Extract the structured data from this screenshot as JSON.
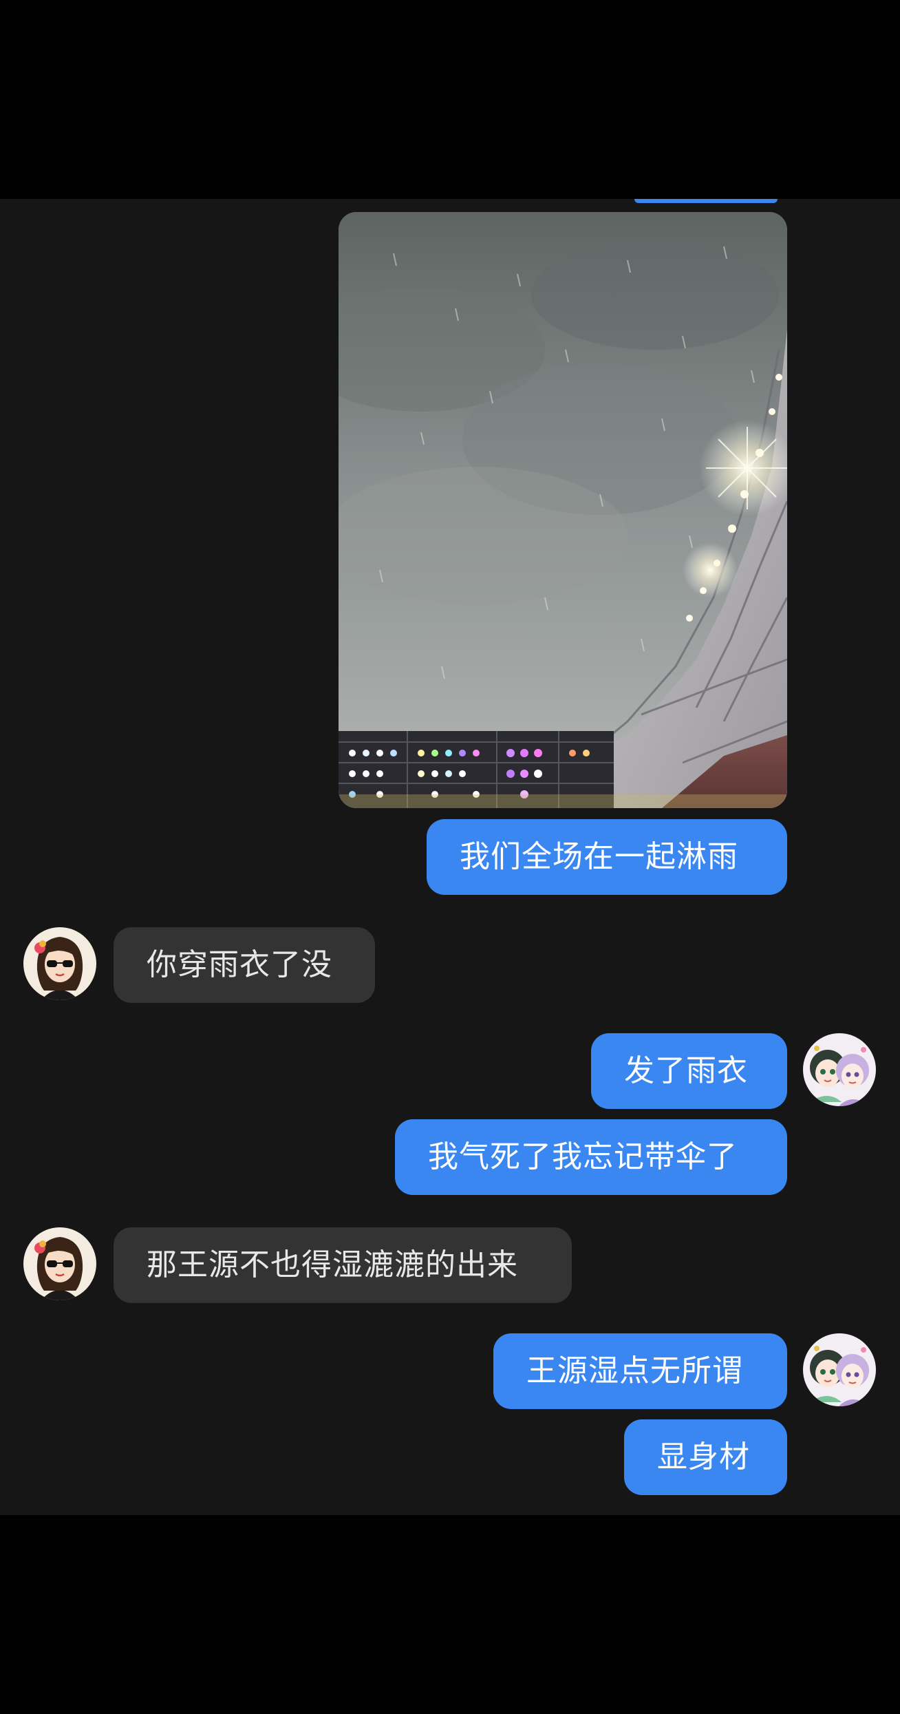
{
  "messages": [
    {
      "id": "m1",
      "from": "me",
      "type": "image",
      "alt": "photo"
    },
    {
      "id": "m2",
      "from": "me",
      "text": "我们全场在一起淋雨"
    },
    {
      "id": "m3",
      "from": "them",
      "text": "你穿雨衣了没"
    },
    {
      "id": "m4",
      "from": "me",
      "text": "发了雨衣"
    },
    {
      "id": "m5",
      "from": "me",
      "text": "我气死了我忘记带伞了"
    },
    {
      "id": "m6",
      "from": "them",
      "text": "那王源不也得湿漉漉的出来"
    },
    {
      "id": "m7",
      "from": "me",
      "text": "王源湿点无所谓"
    },
    {
      "id": "m8",
      "from": "me",
      "text": "显身材"
    }
  ],
  "avatars": {
    "them": "avatar-girl-sunglasses",
    "me": "avatar-cartoon-pair"
  },
  "colors": {
    "screen_background": "#000000",
    "chat_background": "#161616",
    "outgoing_bubble": "#3a87f1",
    "incoming_bubble": "#333333",
    "outgoing_text": "#ffffff",
    "incoming_text": "#e8e8e8"
  }
}
